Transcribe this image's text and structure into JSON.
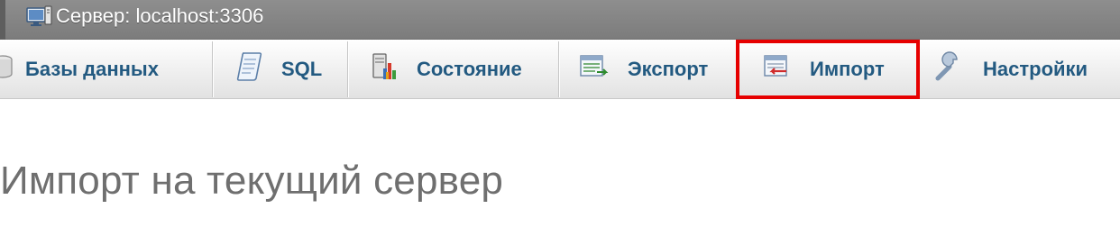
{
  "server_bar": {
    "breadcrumb": "Сервер: localhost:3306",
    "icon": "server-icon"
  },
  "topmenu": {
    "tabs": [
      {
        "label": "Базы данных",
        "icon": "database-icon",
        "active": false
      },
      {
        "label": "SQL",
        "icon": "sql-icon",
        "active": false
      },
      {
        "label": "Состояние",
        "icon": "status-icon",
        "active": false
      },
      {
        "label": "Экспорт",
        "icon": "export-icon",
        "active": false
      },
      {
        "label": "Импорт",
        "icon": "import-icon",
        "active": true
      },
      {
        "label": "Настройки",
        "icon": "wrench-icon",
        "active": false
      }
    ],
    "active_highlight_color": "#e60000",
    "link_color": "#235a81"
  },
  "main": {
    "title": "Импорт на текущий сервер"
  }
}
